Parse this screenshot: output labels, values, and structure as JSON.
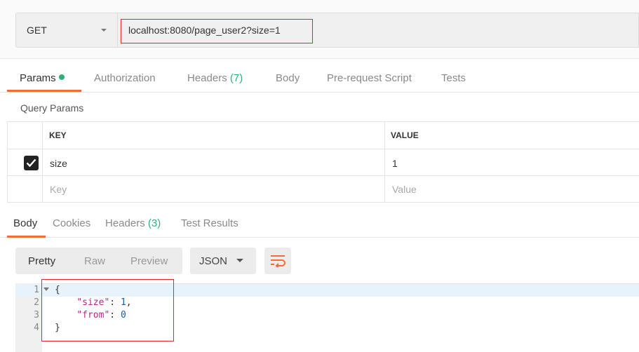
{
  "request": {
    "method": "GET",
    "url": "localhost:8080/page_user2?size=1"
  },
  "request_tabs": {
    "params": "Params",
    "authorization": "Authorization",
    "headers": "Headers",
    "headers_count": "(7)",
    "body": "Body",
    "prerequest": "Pre-request Script",
    "tests": "Tests"
  },
  "query_params": {
    "title": "Query Params",
    "col_key": "KEY",
    "col_value": "VALUE",
    "rows": [
      {
        "checked": true,
        "key": "size",
        "value": "1"
      }
    ],
    "placeholder_key": "Key",
    "placeholder_value": "Value"
  },
  "response_tabs": {
    "body": "Body",
    "cookies": "Cookies",
    "headers": "Headers",
    "headers_count": "(3)",
    "test_results": "Test Results"
  },
  "view": {
    "pretty": "Pretty",
    "raw": "Raw",
    "preview": "Preview",
    "format": "JSON",
    "wrap_icon": "wrap-lines-icon"
  },
  "code": {
    "line_numbers": [
      "1",
      "2",
      "3",
      "4"
    ],
    "line1": "{",
    "line2_key": "\"size\"",
    "line2_sep": ": ",
    "line2_val": "1",
    "line2_end": ",",
    "line3_key": "\"from\"",
    "line3_sep": ": ",
    "line3_val": "0",
    "line4": "}"
  },
  "colors": {
    "accent": "#f26b3a",
    "highlight_box": "#e0282e",
    "count_green": "#2fb07a"
  }
}
